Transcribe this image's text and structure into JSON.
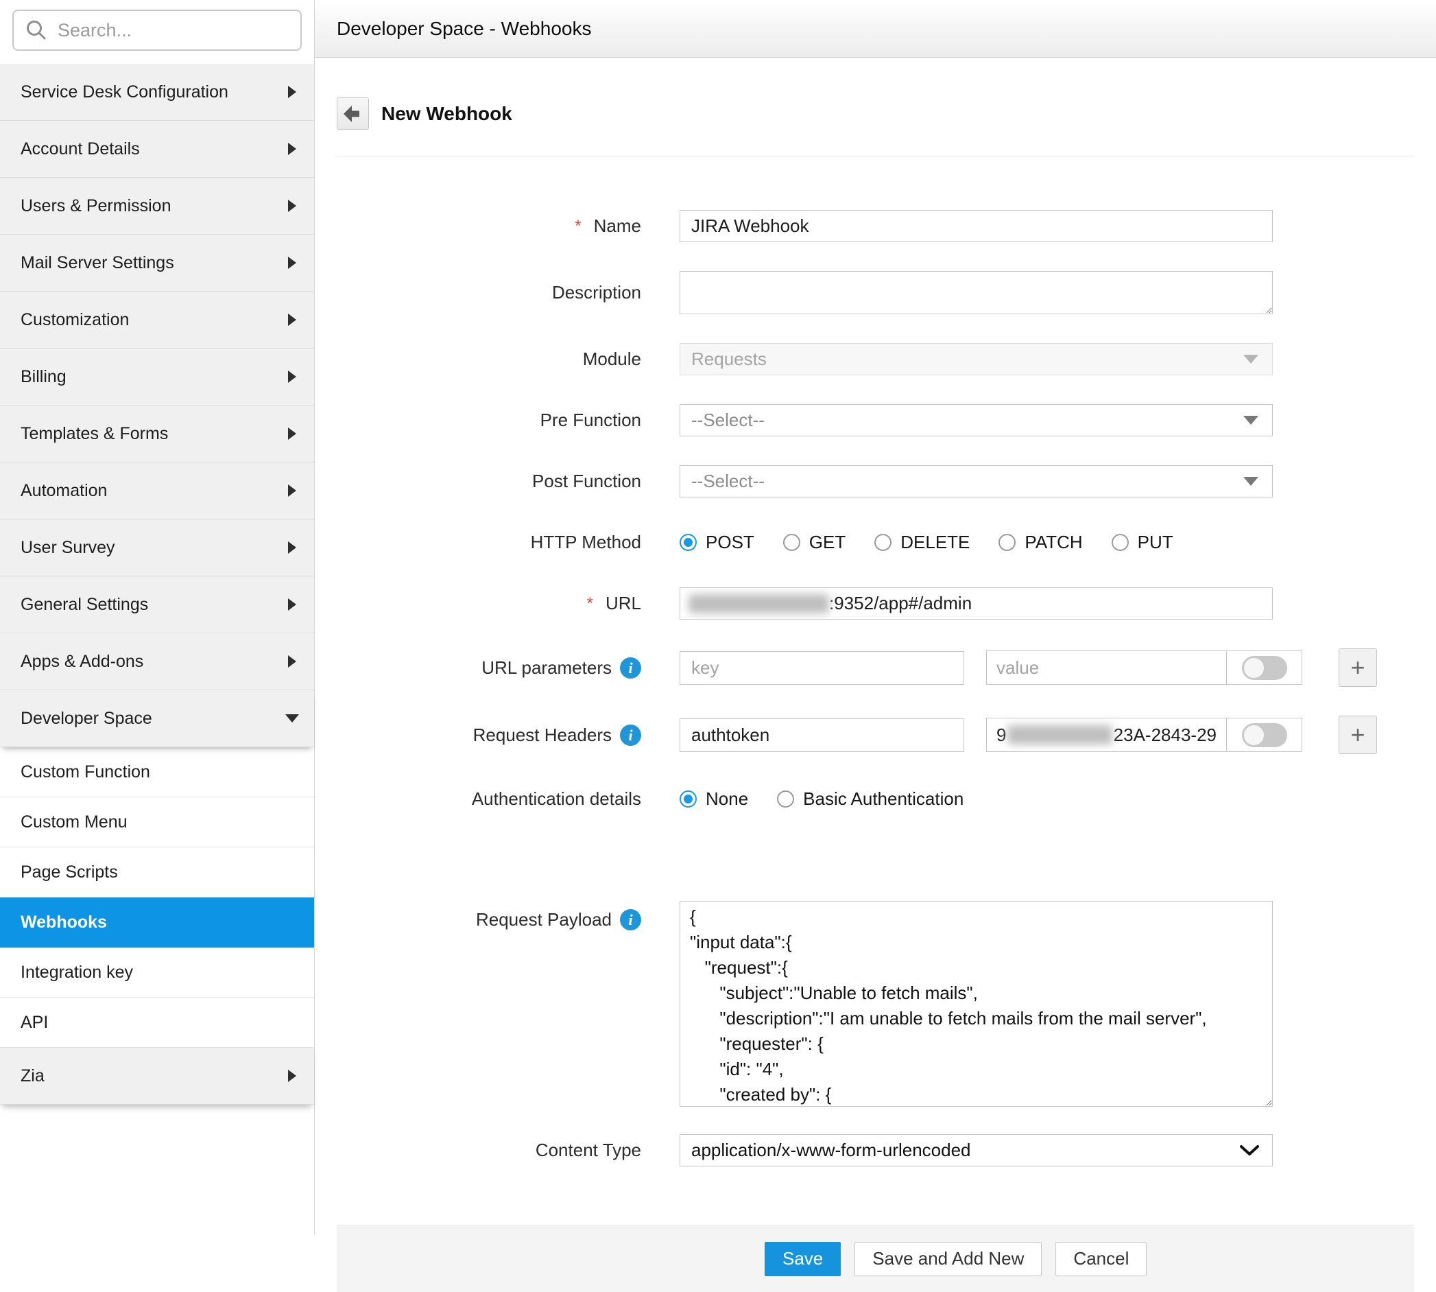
{
  "sidebar": {
    "search_placeholder": "Search...",
    "items": [
      {
        "label": "Service Desk Configuration"
      },
      {
        "label": "Account Details"
      },
      {
        "label": "Users & Permission"
      },
      {
        "label": "Mail Server Settings"
      },
      {
        "label": "Customization"
      },
      {
        "label": "Billing"
      },
      {
        "label": "Templates & Forms"
      },
      {
        "label": "Automation"
      },
      {
        "label": "User Survey"
      },
      {
        "label": "General Settings"
      },
      {
        "label": "Apps & Add-ons"
      },
      {
        "label": "Developer Space"
      }
    ],
    "developer_space_items": [
      {
        "label": "Custom Function"
      },
      {
        "label": "Custom Menu"
      },
      {
        "label": "Page Scripts"
      },
      {
        "label": "Webhooks"
      },
      {
        "label": "Integration key"
      },
      {
        "label": "API"
      }
    ],
    "zia_label": "Zia",
    "selected_item": "Webhooks"
  },
  "header": {
    "title": "Developer Space - Webhooks"
  },
  "page": {
    "title": "New Webhook"
  },
  "form": {
    "name": {
      "label": "Name",
      "required_mark": "*",
      "value": "JIRA Webhook"
    },
    "description": {
      "label": "Description",
      "value": ""
    },
    "module": {
      "label": "Module",
      "value": "Requests",
      "disabled": true
    },
    "pre_function": {
      "label": "Pre Function",
      "value": "--Select--"
    },
    "post_function": {
      "label": "Post Function",
      "value": "--Select--"
    },
    "http_method": {
      "label": "HTTP Method",
      "options": [
        "POST",
        "GET",
        "DELETE",
        "PATCH",
        "PUT"
      ],
      "selected": "POST"
    },
    "url": {
      "label": "URL",
      "required_mark": "*",
      "visible_value": ":9352/app#/admin",
      "redacted_prefix": true
    },
    "url_parameters": {
      "label": "URL parameters",
      "key_placeholder": "key",
      "value_placeholder": "value",
      "toggle_state": "off"
    },
    "request_headers": {
      "label": "Request Headers",
      "key_value": "authtoken",
      "value_prefix": "9",
      "value_visible": "23A-2843-29",
      "redacted_middle": true,
      "toggle_state": "off"
    },
    "authentication": {
      "label": "Authentication details",
      "options": [
        "None",
        "Basic Authentication"
      ],
      "selected": "None"
    },
    "request_payload": {
      "label": "Request Payload",
      "value": "{\n\"input data\":{\n   \"request\":{\n      \"subject\":\"Unable to fetch mails\",\n      \"description\":\"I am unable to fetch mails from the mail server\",\n      \"requester\": {\n      \"id\": \"4\",\n      \"created by\": {"
    },
    "content_type": {
      "label": "Content Type",
      "value": "application/x-www-form-urlencoded"
    }
  },
  "footer": {
    "save_label": "Save",
    "save_add_new_label": "Save and Add New",
    "cancel_label": "Cancel"
  },
  "colors": {
    "accent_blue": "#1593dc",
    "selected_sidebar": "#0e94e4",
    "info_icon": "#1e96d8",
    "required_red": "#d9453d"
  }
}
